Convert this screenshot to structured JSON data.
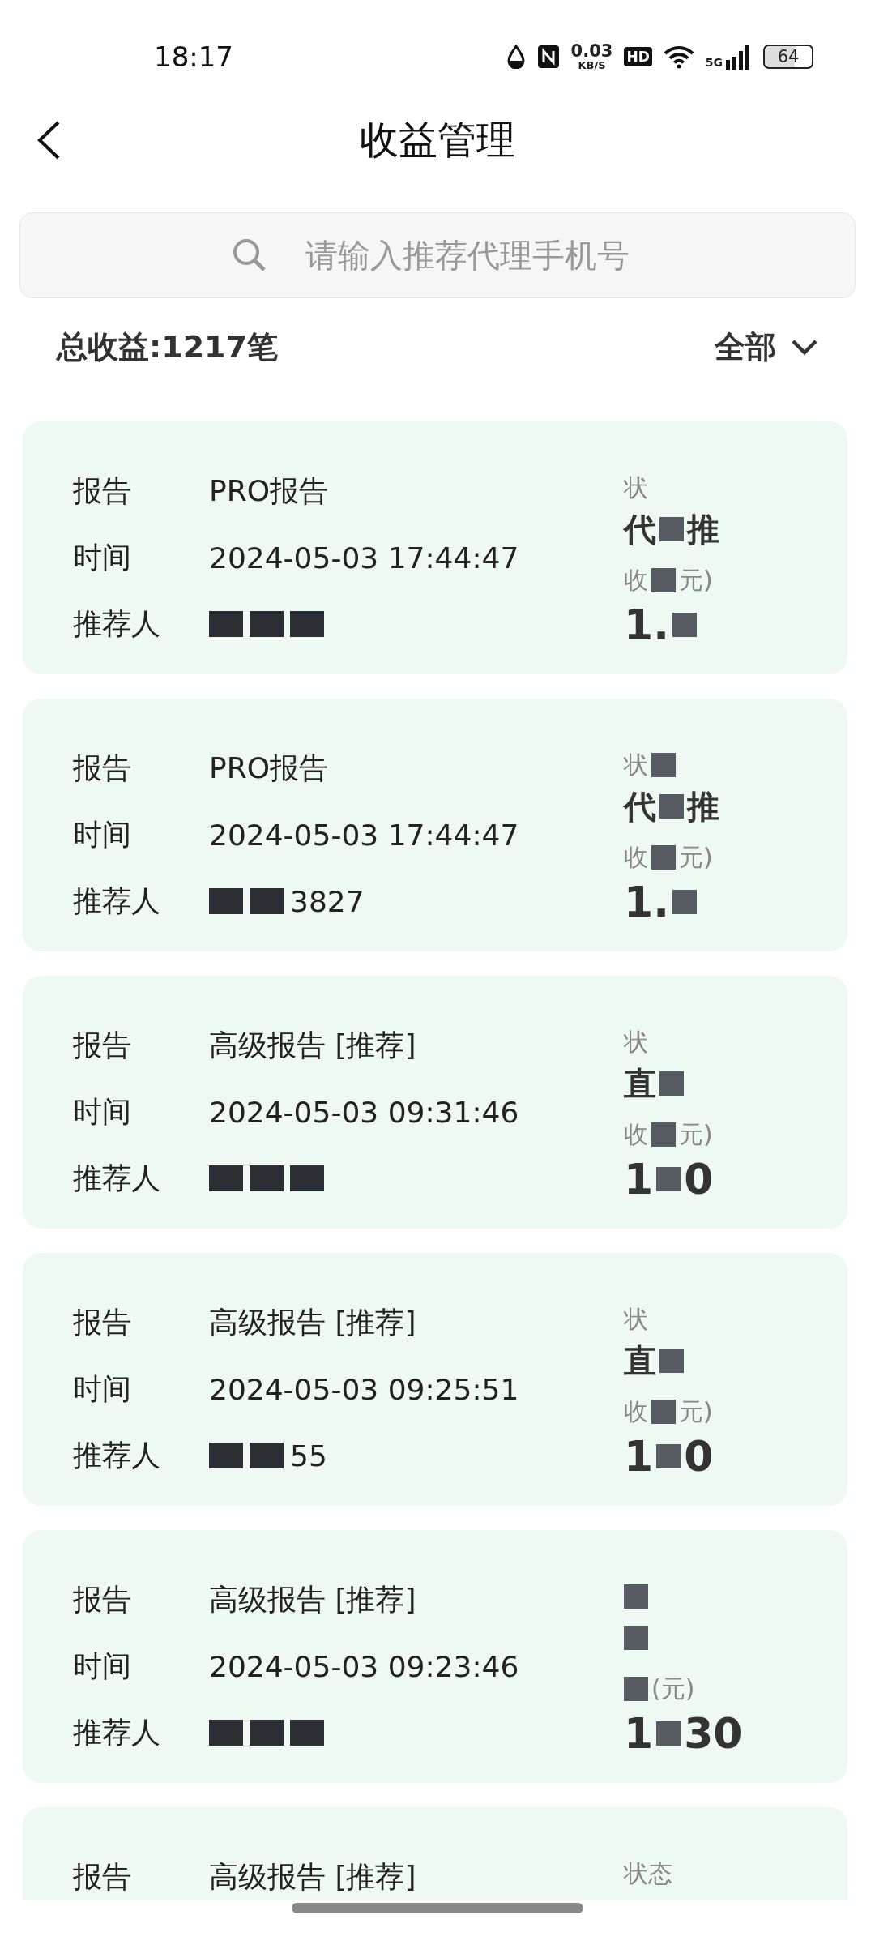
{
  "status_bar": {
    "time": "18:17",
    "speed": "0.03",
    "speed_unit": "KB/S",
    "hd": "HD",
    "network": "5G",
    "battery": "64"
  },
  "header": {
    "title": "收益管理"
  },
  "search": {
    "placeholder": "请输入推荐代理手机号"
  },
  "summary": {
    "total": "总收益:1217笔",
    "filter": "全部"
  },
  "cards": [
    {
      "rows": [
        {
          "label": "报告",
          "value": [
            {
              "kind": "text",
              "text": "PRO报告"
            }
          ]
        },
        {
          "label": "时间",
          "value": [
            {
              "kind": "text",
              "text": "2024-05-03 17:44:47"
            }
          ]
        },
        {
          "label": "推荐人",
          "value": [
            {
              "kind": "redaction"
            },
            {
              "kind": "redaction"
            },
            {
              "kind": "redaction"
            }
          ]
        }
      ],
      "status_label": [
        {
          "kind": "text",
          "text": "状"
        }
      ],
      "status": [
        {
          "kind": "text",
          "text": "代"
        },
        {
          "kind": "redaction"
        },
        {
          "kind": "text",
          "text": "推"
        }
      ],
      "amount_label": [
        {
          "kind": "text",
          "text": "收"
        },
        {
          "kind": "redaction"
        },
        {
          "kind": "text",
          "text": "元)"
        }
      ],
      "amount": [
        {
          "kind": "text",
          "text": "1."
        },
        {
          "kind": "redaction"
        }
      ]
    },
    {
      "rows": [
        {
          "label": "报告",
          "value": [
            {
              "kind": "text",
              "text": "PRO报告"
            }
          ]
        },
        {
          "label": "时间",
          "value": [
            {
              "kind": "text",
              "text": "2024-05-03 17:44:47"
            }
          ]
        },
        {
          "label": "推荐人",
          "value": [
            {
              "kind": "redaction"
            },
            {
              "kind": "redaction"
            },
            {
              "kind": "text",
              "text": "3827"
            }
          ]
        }
      ],
      "status_label": [
        {
          "kind": "text",
          "text": "状"
        },
        {
          "kind": "redaction"
        }
      ],
      "status": [
        {
          "kind": "text",
          "text": "代"
        },
        {
          "kind": "redaction"
        },
        {
          "kind": "text",
          "text": "推"
        }
      ],
      "amount_label": [
        {
          "kind": "text",
          "text": "收"
        },
        {
          "kind": "redaction"
        },
        {
          "kind": "text",
          "text": "元)"
        }
      ],
      "amount": [
        {
          "kind": "text",
          "text": "1."
        },
        {
          "kind": "redaction"
        }
      ]
    },
    {
      "rows": [
        {
          "label": "报告",
          "value": [
            {
              "kind": "text",
              "text": "高级报告 [推荐]"
            }
          ]
        },
        {
          "label": "时间",
          "value": [
            {
              "kind": "text",
              "text": "2024-05-03 09:31:46"
            }
          ]
        },
        {
          "label": "推荐人",
          "value": [
            {
              "kind": "redaction"
            },
            {
              "kind": "redaction"
            },
            {
              "kind": "redaction"
            }
          ]
        }
      ],
      "status_label": [
        {
          "kind": "text",
          "text": "状"
        }
      ],
      "status": [
        {
          "kind": "text",
          "text": "直"
        },
        {
          "kind": "redaction"
        }
      ],
      "amount_label": [
        {
          "kind": "text",
          "text": "收"
        },
        {
          "kind": "redaction"
        },
        {
          "kind": "text",
          "text": "元)"
        }
      ],
      "amount": [
        {
          "kind": "text",
          "text": "1"
        },
        {
          "kind": "redaction"
        },
        {
          "kind": "text",
          "text": "0"
        }
      ]
    },
    {
      "rows": [
        {
          "label": "报告",
          "value": [
            {
              "kind": "text",
              "text": "高级报告 [推荐]"
            }
          ]
        },
        {
          "label": "时间",
          "value": [
            {
              "kind": "text",
              "text": "2024-05-03 09:25:51"
            }
          ]
        },
        {
          "label": "推荐人",
          "value": [
            {
              "kind": "redaction"
            },
            {
              "kind": "redaction"
            },
            {
              "kind": "text",
              "text": "55"
            }
          ]
        }
      ],
      "status_label": [
        {
          "kind": "text",
          "text": "状"
        }
      ],
      "status": [
        {
          "kind": "text",
          "text": "直"
        },
        {
          "kind": "redaction"
        }
      ],
      "amount_label": [
        {
          "kind": "text",
          "text": "收"
        },
        {
          "kind": "redaction"
        },
        {
          "kind": "text",
          "text": "元)"
        }
      ],
      "amount": [
        {
          "kind": "text",
          "text": "1"
        },
        {
          "kind": "redaction"
        },
        {
          "kind": "text",
          "text": "0"
        }
      ]
    },
    {
      "rows": [
        {
          "label": "报告",
          "value": [
            {
              "kind": "text",
              "text": "高级报告 [推荐]"
            }
          ]
        },
        {
          "label": "时间",
          "value": [
            {
              "kind": "text",
              "text": "2024-05-03 09:23:46"
            }
          ]
        },
        {
          "label": "推荐人",
          "value": [
            {
              "kind": "redaction"
            },
            {
              "kind": "redaction"
            },
            {
              "kind": "redaction"
            }
          ]
        }
      ],
      "status_label": [
        {
          "kind": "redaction"
        }
      ],
      "status": [
        {
          "kind": "redaction"
        }
      ],
      "amount_label": [
        {
          "kind": "redaction"
        },
        {
          "kind": "text",
          "text": "(元)"
        }
      ],
      "amount": [
        {
          "kind": "text",
          "text": "1"
        },
        {
          "kind": "redaction"
        },
        {
          "kind": "text",
          "text": "30"
        }
      ]
    },
    {
      "rows": [
        {
          "label": "报告",
          "value": [
            {
              "kind": "text",
              "text": "高级报告 [推荐]"
            }
          ]
        }
      ],
      "status_label": [
        {
          "kind": "text",
          "text": "状态"
        }
      ]
    }
  ]
}
